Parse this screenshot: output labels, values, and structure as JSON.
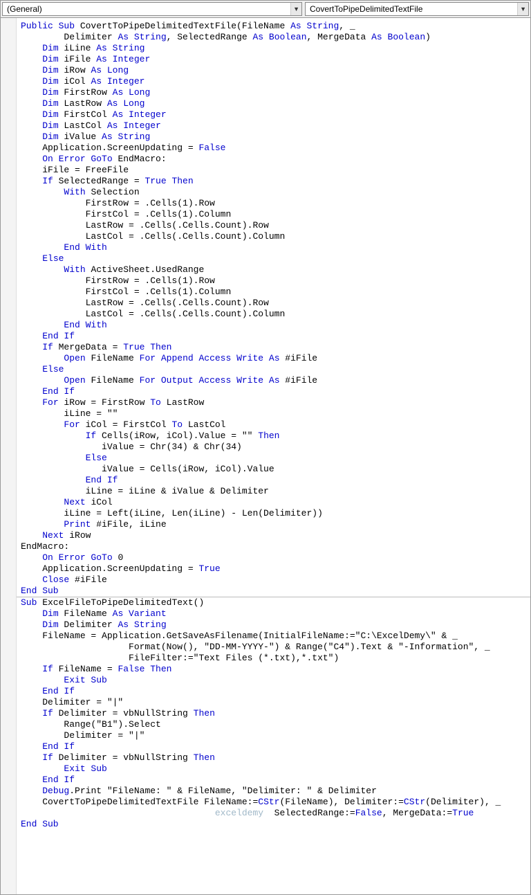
{
  "toolbar": {
    "object_dropdown": "(General)",
    "procedure_dropdown": "CovertToPipeDelimitedTextFile"
  },
  "code_lines": [
    [
      [
        "kw",
        "Public Sub"
      ],
      [
        "",
        " CovertToPipeDelimitedTextFile(FileName "
      ],
      [
        "kw",
        "As String"
      ],
      [
        "",
        ", _"
      ]
    ],
    [
      [
        "",
        "        Delimiter "
      ],
      [
        "kw",
        "As String"
      ],
      [
        "",
        ", SelectedRange "
      ],
      [
        "kw",
        "As Boolean"
      ],
      [
        "",
        ", MergeData "
      ],
      [
        "kw",
        "As Boolean"
      ],
      [
        "",
        ")"
      ]
    ],
    [
      [
        "",
        ""
      ]
    ],
    [
      [
        "",
        "    "
      ],
      [
        "kw",
        "Dim"
      ],
      [
        "",
        " iLine "
      ],
      [
        "kw",
        "As String"
      ]
    ],
    [
      [
        "",
        "    "
      ],
      [
        "kw",
        "Dim"
      ],
      [
        "",
        " iFile "
      ],
      [
        "kw",
        "As Integer"
      ]
    ],
    [
      [
        "",
        "    "
      ],
      [
        "kw",
        "Dim"
      ],
      [
        "",
        " iRow "
      ],
      [
        "kw",
        "As Long"
      ]
    ],
    [
      [
        "",
        "    "
      ],
      [
        "kw",
        "Dim"
      ],
      [
        "",
        " iCol "
      ],
      [
        "kw",
        "As Integer"
      ]
    ],
    [
      [
        "",
        "    "
      ],
      [
        "kw",
        "Dim"
      ],
      [
        "",
        " FirstRow "
      ],
      [
        "kw",
        "As Long"
      ]
    ],
    [
      [
        "",
        "    "
      ],
      [
        "kw",
        "Dim"
      ],
      [
        "",
        " LastRow "
      ],
      [
        "kw",
        "As Long"
      ]
    ],
    [
      [
        "",
        "    "
      ],
      [
        "kw",
        "Dim"
      ],
      [
        "",
        " FirstCol "
      ],
      [
        "kw",
        "As Integer"
      ]
    ],
    [
      [
        "",
        "    "
      ],
      [
        "kw",
        "Dim"
      ],
      [
        "",
        " LastCol "
      ],
      [
        "kw",
        "As Integer"
      ]
    ],
    [
      [
        "",
        "    "
      ],
      [
        "kw",
        "Dim"
      ],
      [
        "",
        " iValue "
      ],
      [
        "kw",
        "As String"
      ]
    ],
    [
      [
        "",
        ""
      ]
    ],
    [
      [
        "",
        "    Application.ScreenUpdating = "
      ],
      [
        "kw",
        "False"
      ]
    ],
    [
      [
        "",
        "    "
      ],
      [
        "kw",
        "On Error GoTo"
      ],
      [
        "",
        " EndMacro:"
      ]
    ],
    [
      [
        "",
        "    iFile = FreeFile"
      ]
    ],
    [
      [
        "",
        "    "
      ],
      [
        "kw",
        "If"
      ],
      [
        "",
        " SelectedRange = "
      ],
      [
        "kw",
        "True Then"
      ]
    ],
    [
      [
        "",
        "        "
      ],
      [
        "kw",
        "With"
      ],
      [
        "",
        " Selection"
      ]
    ],
    [
      [
        "",
        "            FirstRow = .Cells(1).Row"
      ]
    ],
    [
      [
        "",
        "            FirstCol = .Cells(1).Column"
      ]
    ],
    [
      [
        "",
        "            LastRow = .Cells(.Cells.Count).Row"
      ]
    ],
    [
      [
        "",
        "            LastCol = .Cells(.Cells.Count).Column"
      ]
    ],
    [
      [
        "",
        "        "
      ],
      [
        "kw",
        "End With"
      ]
    ],
    [
      [
        "",
        "    "
      ],
      [
        "kw",
        "Else"
      ]
    ],
    [
      [
        "",
        "        "
      ],
      [
        "kw",
        "With"
      ],
      [
        "",
        " ActiveSheet.UsedRange"
      ]
    ],
    [
      [
        "",
        "            FirstRow = .Cells(1).Row"
      ]
    ],
    [
      [
        "",
        "            FirstCol = .Cells(1).Column"
      ]
    ],
    [
      [
        "",
        "            LastRow = .Cells(.Cells.Count).Row"
      ]
    ],
    [
      [
        "",
        "            LastCol = .Cells(.Cells.Count).Column"
      ]
    ],
    [
      [
        "",
        "        "
      ],
      [
        "kw",
        "End With"
      ]
    ],
    [
      [
        "",
        "    "
      ],
      [
        "kw",
        "End If"
      ]
    ],
    [
      [
        "",
        "    "
      ],
      [
        "kw",
        "If"
      ],
      [
        "",
        " MergeData = "
      ],
      [
        "kw",
        "True Then"
      ]
    ],
    [
      [
        "",
        "        "
      ],
      [
        "kw",
        "Open"
      ],
      [
        "",
        " FileName "
      ],
      [
        "kw",
        "For Append Access Write As"
      ],
      [
        "",
        " #iFile"
      ]
    ],
    [
      [
        "",
        "    "
      ],
      [
        "kw",
        "Else"
      ]
    ],
    [
      [
        "",
        "        "
      ],
      [
        "kw",
        "Open"
      ],
      [
        "",
        " FileName "
      ],
      [
        "kw",
        "For Output Access Write As"
      ],
      [
        "",
        " #iFile"
      ]
    ],
    [
      [
        "",
        "    "
      ],
      [
        "kw",
        "End If"
      ]
    ],
    [
      [
        "",
        "    "
      ],
      [
        "kw",
        "For"
      ],
      [
        "",
        " iRow = FirstRow "
      ],
      [
        "kw",
        "To"
      ],
      [
        "",
        " LastRow"
      ]
    ],
    [
      [
        "",
        "        iLine = \"\""
      ]
    ],
    [
      [
        "",
        "        "
      ],
      [
        "kw",
        "For"
      ],
      [
        "",
        " iCol = FirstCol "
      ],
      [
        "kw",
        "To"
      ],
      [
        "",
        " LastCol"
      ]
    ],
    [
      [
        "",
        "            "
      ],
      [
        "kw",
        "If"
      ],
      [
        "",
        " Cells(iRow, iCol).Value = \"\" "
      ],
      [
        "kw",
        "Then"
      ]
    ],
    [
      [
        "",
        "               iValue = Chr(34) & Chr(34)"
      ]
    ],
    [
      [
        "",
        "            "
      ],
      [
        "kw",
        "Else"
      ]
    ],
    [
      [
        "",
        "               iValue = Cells(iRow, iCol).Value"
      ]
    ],
    [
      [
        "",
        "            "
      ],
      [
        "kw",
        "End If"
      ]
    ],
    [
      [
        "",
        "            iLine = iLine & iValue & Delimiter"
      ]
    ],
    [
      [
        "",
        "        "
      ],
      [
        "kw",
        "Next"
      ],
      [
        "",
        " iCol"
      ]
    ],
    [
      [
        "",
        "        iLine = Left(iLine, Len(iLine) - Len(Delimiter))"
      ]
    ],
    [
      [
        "",
        "        "
      ],
      [
        "kw",
        "Print"
      ],
      [
        "",
        " #iFile, iLine"
      ]
    ],
    [
      [
        "",
        "    "
      ],
      [
        "kw",
        "Next"
      ],
      [
        "",
        " iRow"
      ]
    ],
    [
      [
        "",
        "EndMacro:"
      ]
    ],
    [
      [
        "",
        "    "
      ],
      [
        "kw",
        "On Error GoTo"
      ],
      [
        "",
        " 0"
      ]
    ],
    [
      [
        "",
        "    Application.ScreenUpdating = "
      ],
      [
        "kw",
        "True"
      ]
    ],
    [
      [
        "",
        "    "
      ],
      [
        "kw",
        "Close"
      ],
      [
        "",
        " #iFile"
      ]
    ],
    [
      [
        "kw",
        "End Sub"
      ]
    ],
    "divider",
    [
      [
        "kw",
        "Sub"
      ],
      [
        "",
        " ExcelFileToPipeDelimitedText()"
      ]
    ],
    [
      [
        "",
        ""
      ]
    ],
    [
      [
        "",
        "    "
      ],
      [
        "kw",
        "Dim"
      ],
      [
        "",
        " FileName "
      ],
      [
        "kw",
        "As Variant"
      ]
    ],
    [
      [
        "",
        "    "
      ],
      [
        "kw",
        "Dim"
      ],
      [
        "",
        " Delimiter "
      ],
      [
        "kw",
        "As String"
      ]
    ],
    [
      [
        "",
        ""
      ]
    ],
    [
      [
        "",
        "    FileName = Application.GetSaveAsFilename(InitialFileName:=\"C:\\ExcelDemy\\\" & _"
      ]
    ],
    [
      [
        "",
        "                    Format(Now(), \"DD-MM-YYYY-\") & Range(\"C4\").Text & \"-Information\", _"
      ]
    ],
    [
      [
        "",
        "                    FileFilter:=\"Text Files (*.txt),*.txt\")"
      ]
    ],
    [
      [
        "",
        "    "
      ],
      [
        "kw",
        "If"
      ],
      [
        "",
        " FileName = "
      ],
      [
        "kw",
        "False Then"
      ]
    ],
    [
      [
        "",
        "        "
      ],
      [
        "kw",
        "Exit Sub"
      ]
    ],
    [
      [
        "",
        "    "
      ],
      [
        "kw",
        "End If"
      ]
    ],
    [
      [
        "",
        "    Delimiter = \"|\""
      ]
    ],
    [
      [
        "",
        "    "
      ],
      [
        "kw",
        "If"
      ],
      [
        "",
        " Delimiter = vbNullString "
      ],
      [
        "kw",
        "Then"
      ]
    ],
    [
      [
        "",
        "        Range(\"B1\").Select"
      ]
    ],
    [
      [
        "",
        "        Delimiter = \"|\""
      ]
    ],
    [
      [
        "",
        "    "
      ],
      [
        "kw",
        "End If"
      ]
    ],
    [
      [
        "",
        ""
      ]
    ],
    [
      [
        "",
        "    "
      ],
      [
        "kw",
        "If"
      ],
      [
        "",
        " Delimiter = vbNullString "
      ],
      [
        "kw",
        "Then"
      ]
    ],
    [
      [
        "",
        "        "
      ],
      [
        "kw",
        "Exit Sub"
      ]
    ],
    [
      [
        "",
        "    "
      ],
      [
        "kw",
        "End If"
      ]
    ],
    [
      [
        "",
        "    "
      ],
      [
        "kw",
        "Debug"
      ],
      [
        "",
        ".Print \"FileName: \" & FileName, \"Delimiter: \" & Delimiter"
      ]
    ],
    [
      [
        "",
        "    CovertToPipeDelimitedTextFile FileName:="
      ],
      [
        "kw",
        "CStr"
      ],
      [
        "",
        "(FileName), Delimiter:="
      ],
      [
        "kw",
        "CStr"
      ],
      [
        "",
        "(Delimiter), _"
      ]
    ],
    [
      [
        "",
        "                                    "
      ],
      [
        "pale",
        "exceldemy"
      ],
      [
        "",
        "  SelectedRange:="
      ],
      [
        "kw",
        "False"
      ],
      [
        "",
        ", MergeData:="
      ],
      [
        "kw",
        "True"
      ]
    ],
    [
      [
        "kw",
        "End Sub"
      ]
    ]
  ]
}
